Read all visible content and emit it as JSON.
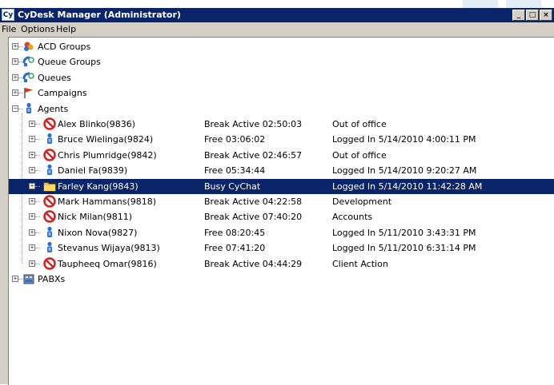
{
  "window": {
    "app_icon": "Cy",
    "title": "CyDesk Manager (Administrator)",
    "controls": [
      "_",
      "□",
      "×"
    ]
  },
  "menu": [
    "File",
    "Options",
    "Help"
  ],
  "tree": {
    "groups": [
      {
        "label": "ACD Groups",
        "icon": "acd-groups-icon",
        "expander": "+"
      },
      {
        "label": "Queue Groups",
        "icon": "queue-groups-icon",
        "expander": "+"
      },
      {
        "label": "Queues",
        "icon": "queues-icon",
        "expander": "+"
      },
      {
        "label": "Campaigns",
        "icon": "campaign-flag-icon",
        "expander": "+"
      },
      {
        "label": "Agents",
        "icon": "agent-icon",
        "expander": "−"
      }
    ],
    "agents": [
      {
        "name": "Alex Blinko(9836)",
        "state": "Break Active  02:50:03",
        "detail": "Out of office",
        "icon": "break-icon",
        "expander": "+"
      },
      {
        "name": "Bruce Wielinga(9824)",
        "state": "Free 03:06:02",
        "detail": "Logged In 5/14/2010 4:00:11 PM",
        "icon": "agent-free-icon",
        "expander": "+"
      },
      {
        "name": "Chris Plumridge(9842)",
        "state": "Break Active  02:46:57",
        "detail": "Out of office",
        "icon": "break-icon",
        "expander": "+"
      },
      {
        "name": "Daniel Fa(9839)",
        "state": "Free 05:34:44",
        "detail": "Logged In 5/14/2010 9:20:27 AM",
        "icon": "agent-free-icon",
        "expander": "+"
      },
      {
        "name": "Farley Kang(9843)",
        "state": "Busy CyChat",
        "detail": "Logged In 5/14/2010 11:42:28 AM",
        "icon": "busy-folder-icon",
        "expander": "+",
        "selected": true
      },
      {
        "name": "Mark Hammans(9818)",
        "state": "Break Active  04:22:58",
        "detail": "Development",
        "icon": "break-icon",
        "expander": "+"
      },
      {
        "name": "Nick Milan(9811)",
        "state": "Break Active  07:40:20",
        "detail": "Accounts",
        "icon": "break-icon",
        "expander": "+"
      },
      {
        "name": "Nixon Nova(9827)",
        "state": "Free 08:20:45",
        "detail": "Logged In 5/11/2010 3:43:31 PM",
        "icon": "agent-free-icon",
        "expander": "+"
      },
      {
        "name": "Stevanus Wijaya(9813)",
        "state": "Free 07:41:20",
        "detail": "Logged In 5/11/2010 6:31:14 PM",
        "icon": "agent-free-icon",
        "expander": "+"
      },
      {
        "name": "Taupheeq Omar(9816)",
        "state": "Break Active  04:44:29",
        "detail": "Client Action",
        "icon": "break-icon",
        "expander": "+"
      }
    ],
    "pabx": {
      "label": "PABXs",
      "icon": "pabx-icon",
      "expander": "+"
    }
  },
  "colors": {
    "titlebar": "#0a246a",
    "selection": "#0a246a",
    "chrome": "#d4d0c8",
    "break_red": "#d32020",
    "agent_blue": "#2a6fd0"
  }
}
